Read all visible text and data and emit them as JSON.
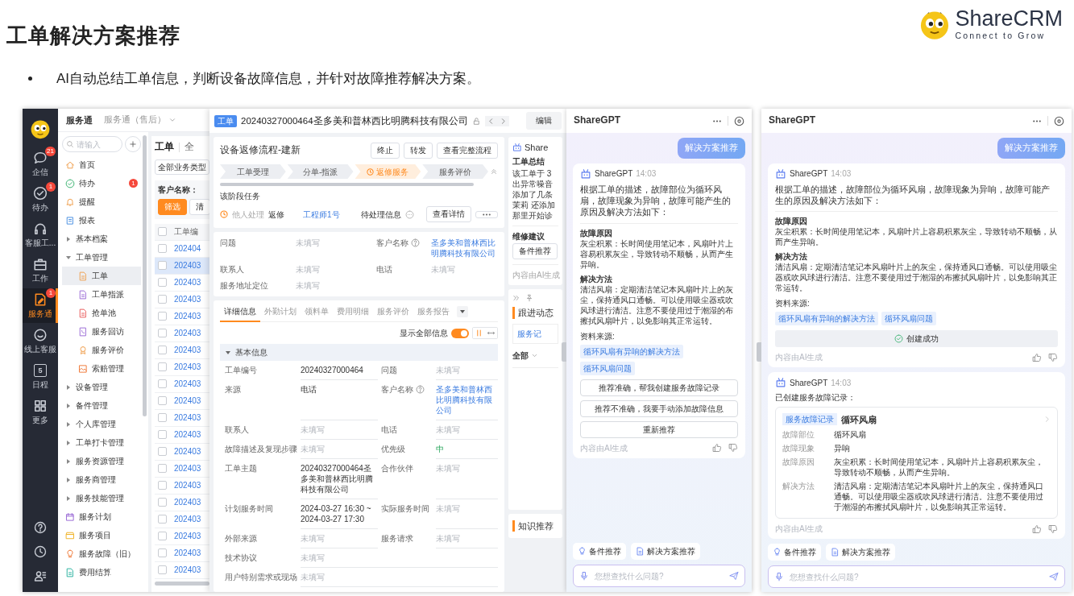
{
  "slide": {
    "title": "工单解决方案推荐",
    "bullet": "AI自动总结工单信息，判断设备故障信息，并针对故障推荐解决方案。",
    "logo": {
      "name": "ShareCRM",
      "tagline": "Connect to Grow"
    }
  },
  "app": {
    "rail": {
      "items": [
        {
          "label": "企信",
          "badge": "21",
          "selected": false
        },
        {
          "label": "待办",
          "badge": "1",
          "selected": false
        },
        {
          "label": "客服工...",
          "selected": false
        },
        {
          "label": "工作",
          "selected": false
        },
        {
          "label": "服务通",
          "badge": "1",
          "selected": true
        },
        {
          "label": "线上客服",
          "selected": false
        },
        {
          "label": "日程",
          "icon_text": "5",
          "selected": false
        },
        {
          "label": "更多",
          "selected": false
        }
      ]
    },
    "topbar": {
      "title": "服务通",
      "switcher": "服务通（售后）"
    },
    "search": {
      "placeholder": "请输入"
    },
    "nav": [
      {
        "label": "首页",
        "kind": "page",
        "selected": false
      },
      {
        "label": "待办",
        "kind": "page",
        "selected": false,
        "badge": "1"
      },
      {
        "label": "提醒",
        "kind": "page",
        "selected": false
      },
      {
        "label": "报表",
        "kind": "page",
        "selected": false
      },
      {
        "label": "基本档案",
        "kind": "group",
        "selected": false,
        "expanded": false
      },
      {
        "label": "工单管理",
        "kind": "group",
        "selected": false,
        "expanded": true,
        "children": [
          {
            "label": "工单",
            "kind": "page",
            "selected": true
          },
          {
            "label": "工单指派",
            "kind": "page",
            "selected": false
          },
          {
            "label": "抢单池",
            "kind": "page",
            "selected": false
          },
          {
            "label": "服务回访",
            "kind": "page",
            "selected": false
          },
          {
            "label": "服务评价",
            "kind": "page",
            "selected": false
          },
          {
            "label": "索赔管理",
            "kind": "page",
            "selected": false
          }
        ]
      },
      {
        "label": "设备管理",
        "kind": "group",
        "selected": false,
        "expanded": false
      },
      {
        "label": "备件管理",
        "kind": "group",
        "selected": false,
        "expanded": false
      },
      {
        "label": "个人库管理",
        "kind": "group",
        "selected": false,
        "expanded": false
      },
      {
        "label": "工单打卡管理",
        "kind": "group",
        "selected": false,
        "expanded": false
      },
      {
        "label": "服务资源管理",
        "kind": "group",
        "selected": false,
        "expanded": false
      },
      {
        "label": "服务商管理",
        "kind": "group",
        "selected": false,
        "expanded": false
      },
      {
        "label": "服务技能管理",
        "kind": "group",
        "selected": false,
        "expanded": false
      },
      {
        "label": "服务计划",
        "kind": "page",
        "selected": false
      },
      {
        "label": "服务项目",
        "kind": "page",
        "selected": false
      },
      {
        "label": "服务故障（旧）",
        "kind": "page",
        "selected": false
      },
      {
        "label": "费用结算",
        "kind": "page",
        "selected": false
      }
    ],
    "list": {
      "tabs": [
        {
          "label": "工单",
          "selected": true
        },
        {
          "label": "全",
          "selected": false
        }
      ],
      "type_filter": "全部业务类型",
      "filter_label": "客户名称：",
      "buttons": [
        "筛选",
        "清"
      ],
      "column": "工单编",
      "header_checked": false,
      "rows": [
        {
          "id": "202404",
          "selected": false,
          "checked": false
        },
        {
          "id": "202403",
          "selected": true,
          "checked": false
        },
        {
          "id": "202403",
          "selected": false,
          "checked": false
        },
        {
          "id": "202403",
          "selected": false,
          "checked": false
        },
        {
          "id": "202403",
          "selected": false,
          "checked": false
        },
        {
          "id": "202403",
          "selected": false,
          "checked": false
        },
        {
          "id": "202403",
          "selected": false,
          "checked": false
        },
        {
          "id": "202403",
          "selected": false,
          "checked": false
        },
        {
          "id": "202403",
          "selected": false,
          "checked": false
        },
        {
          "id": "202403",
          "selected": false,
          "checked": false
        },
        {
          "id": "202403",
          "selected": false,
          "checked": false
        },
        {
          "id": "202403",
          "selected": false,
          "checked": false
        },
        {
          "id": "202403",
          "selected": false,
          "checked": false
        },
        {
          "id": "202403",
          "selected": false,
          "checked": false
        },
        {
          "id": "202403",
          "selected": false,
          "checked": false
        },
        {
          "id": "202403",
          "selected": false,
          "checked": false
        },
        {
          "id": "202403",
          "selected": false,
          "checked": false
        },
        {
          "id": "202403",
          "selected": false,
          "checked": false
        },
        {
          "id": "202403",
          "selected": false,
          "checked": false
        },
        {
          "id": "202403",
          "selected": false,
          "checked": false
        }
      ]
    },
    "detail": {
      "tag": "工单",
      "title": "20240327000464圣多美和普林西比明腾科技有限公司",
      "edit": "编辑",
      "flow": {
        "title": "设备返修流程-建新",
        "buttons": [
          "终止",
          "转发",
          "查看完整流程"
        ],
        "steps": [
          {
            "label": "工单受理",
            "selected": false
          },
          {
            "label": "分单-指派",
            "selected": false
          },
          {
            "label": "返修服务",
            "selected": true
          },
          {
            "label": "服务评价",
            "selected": false
          }
        ],
        "task_label": "该阶段任务",
        "task": {
          "status": "他人处理",
          "name": "返修",
          "assignee": "工程师1号",
          "pending": "待处理信息",
          "detail_button": "查看详情"
        }
      },
      "summary_fields": [
        {
          "label": "问题",
          "value": "未填写",
          "kind": "empty",
          "help": false
        },
        {
          "label": "客户名称",
          "value": "圣多美和普林西比明腾科技有限公司",
          "kind": "link",
          "help": true
        },
        {
          "label": "联系人",
          "value": "未填写",
          "kind": "empty",
          "help": false
        },
        {
          "label": "电话",
          "value": "未填写",
          "kind": "empty",
          "help": false
        },
        {
          "label": "服务地址定位",
          "value": "未填写",
          "kind": "empty",
          "help": false
        }
      ],
      "tabs": [
        {
          "label": "详细信息",
          "selected": true
        },
        {
          "label": "外勤计划",
          "selected": false
        },
        {
          "label": "领料单",
          "selected": false
        },
        {
          "label": "费用明细",
          "selected": false
        },
        {
          "label": "服务评价",
          "selected": false
        },
        {
          "label": "服务报告",
          "selected": false
        }
      ],
      "show_all": {
        "label": "显示全部信息",
        "on": true
      },
      "section": {
        "title": "基本信息",
        "expanded": true,
        "rows": [
          {
            "fields": [
              {
                "label": "工单编号",
                "value": "20240327000464",
                "kind": "text",
                "help": false
              },
              {
                "label": "问题",
                "value": "未填写",
                "kind": "empty",
                "help": false
              }
            ]
          },
          {
            "fields": [
              {
                "label": "来源",
                "value": "电话",
                "kind": "text",
                "help": false
              },
              {
                "label": "客户名称",
                "value": "圣多美和普林西比明腾科技有限公司",
                "kind": "link",
                "help": true
              }
            ]
          },
          {
            "fields": [
              {
                "label": "联系人",
                "value": "未填写",
                "kind": "empty",
                "help": false
              },
              {
                "label": "电话",
                "value": "未填写",
                "kind": "empty",
                "help": false
              }
            ]
          },
          {
            "fields": [
              {
                "label": "故障描述及复现步骤",
                "value": "未填写",
                "kind": "empty",
                "help": false
              },
              {
                "label": "优先级",
                "value": "中",
                "kind": "priority",
                "help": false
              }
            ]
          },
          {
            "fields": [
              {
                "label": "工单主题",
                "value": "20240327000464圣多美和普林西比明腾科技有限公司",
                "kind": "text",
                "help": false
              },
              {
                "label": "合作伙伴",
                "value": "未填写",
                "kind": "empty",
                "help": false
              }
            ]
          },
          {
            "fields": [
              {
                "label": "计划服务时间",
                "value": "2024-03-27 16:30 ~ 2024-03-27 17:30",
                "kind": "text",
                "help": false
              },
              {
                "label": "实际服务时间",
                "value": "未填写",
                "kind": "empty",
                "help": false
              }
            ]
          },
          {
            "fields": [
              {
                "label": "外部来源",
                "value": "未填写",
                "kind": "empty",
                "help": false
              },
              {
                "label": "服务请求",
                "value": "未填写",
                "kind": "empty",
                "help": false
              }
            ]
          },
          {
            "fields": [
              {
                "label": "技术协议",
                "value": "未填写",
                "kind": "empty",
                "help": false
              }
            ]
          },
          {
            "fields": [
              {
                "label": "用户特别需求或现场",
                "value": "未填写",
                "kind": "empty",
                "help": false
              }
            ]
          }
        ]
      }
    },
    "side": {
      "assistant": "Share",
      "summary_title": "工单总结",
      "summary_lines": [
        "该工单于 3",
        "出异常噪音",
        "添加了几条",
        "茉莉 还添加",
        "那里开始诊"
      ],
      "advice_title": "维修建议",
      "parts_button": "备件推荐",
      "ai_note": "内容由AI生成",
      "follow_title": "跟进动态",
      "record_button": "服务记",
      "filter": "全部",
      "knowledge_title": "知识推荐"
    },
    "assistant": {
      "title": "ShareGPT",
      "user_message": "解决方案推荐",
      "messages": [
        {
          "kind": "solution",
          "sender": "ShareGPT",
          "time": "14:03",
          "intro": "根据工单的描述，故障部位为循环风扇，故障现象为异响，故障可能产生的原因及解决方法如下：",
          "sections": [
            {
              "heading": "故障原因",
              "text": "灰尘积累：长时间使用笔记本，风扇叶片上容易积累灰尘，导致转动不顺畅，从而产生异响。"
            },
            {
              "heading": "解决方法",
              "text": "清洁风扇：定期清洁笔记本风扇叶片上的灰尘，保持通风口通畅。可以使用吸尘器或吹风球进行清洁。注意不要使用过于潮湿的布擦拭风扇叶片，以免影响其正常运转。"
            }
          ],
          "sources_label": "资料来源:",
          "sources": [
            "循环风扇有异响的解决方法",
            "循环风扇问题"
          ],
          "actions": [
            "推荐准确，帮我创建服务故障记录",
            "推荐不准确，我要手动添加故障信息",
            "重新推荐"
          ],
          "footer": "内容由AI生成"
        }
      ],
      "chips": [
        "备件推荐",
        "解决方案推荐"
      ],
      "placeholder": "您想查找什么问题?"
    }
  },
  "assistant_result": {
    "title": "ShareGPT",
    "user_message": "解决方案推荐",
    "messages": [
      {
        "kind": "solution",
        "sender": "ShareGPT",
        "time": "14:03",
        "intro": "根据工单的描述，故障部位为循环风扇，故障现象为异响，故障可能产生的原因及解决方法如下：",
        "sections": [
          {
            "heading": "故障原因",
            "text": "灰尘积累：长时间使用笔记本，风扇叶片上容易积累灰尘，导致转动不顺畅，从而产生异响。"
          },
          {
            "heading": "解决方法",
            "text": "清洁风扇：定期清洁笔记本风扇叶片上的灰尘，保持通风口通畅。可以使用吸尘器或吹风球进行清洁。注意不要使用过于潮湿的布擦拭风扇叶片，以免影响其正常运转。"
          }
        ],
        "sources_label": "资料来源:",
        "sources": [
          "循环风扇有异响的解决方法",
          "循环风扇问题"
        ],
        "status": "创建成功",
        "footer": "内容由AI生成"
      },
      {
        "kind": "record",
        "sender": "ShareGPT",
        "time": "14:03",
        "text": "已创建服务故障记录：",
        "record": {
          "tag": "服务故障记录",
          "title": "循环风扇",
          "fields": [
            {
              "label": "故障部位",
              "value": "循环风扇"
            },
            {
              "label": "故障现象",
              "value": "异响"
            },
            {
              "label": "故障原因",
              "value": "灰尘积累：长时间使用笔记本，风扇叶片上容易积累灰尘，导致转动不顺畅，从而产生异响。"
            },
            {
              "label": "解决方法",
              "value": "清洁风扇：定期清洁笔记本风扇叶片上的灰尘，保持通风口通畅。可以使用吸尘器或吹风球进行清洁。注意不要使用过于潮湿的布擦拭风扇叶片，以免影响其正常运转。"
            }
          ]
        },
        "footer": "内容由AI生成"
      }
    ],
    "chips": [
      "备件推荐",
      "解决方案推荐"
    ],
    "placeholder": "您想查找什么问题?"
  }
}
